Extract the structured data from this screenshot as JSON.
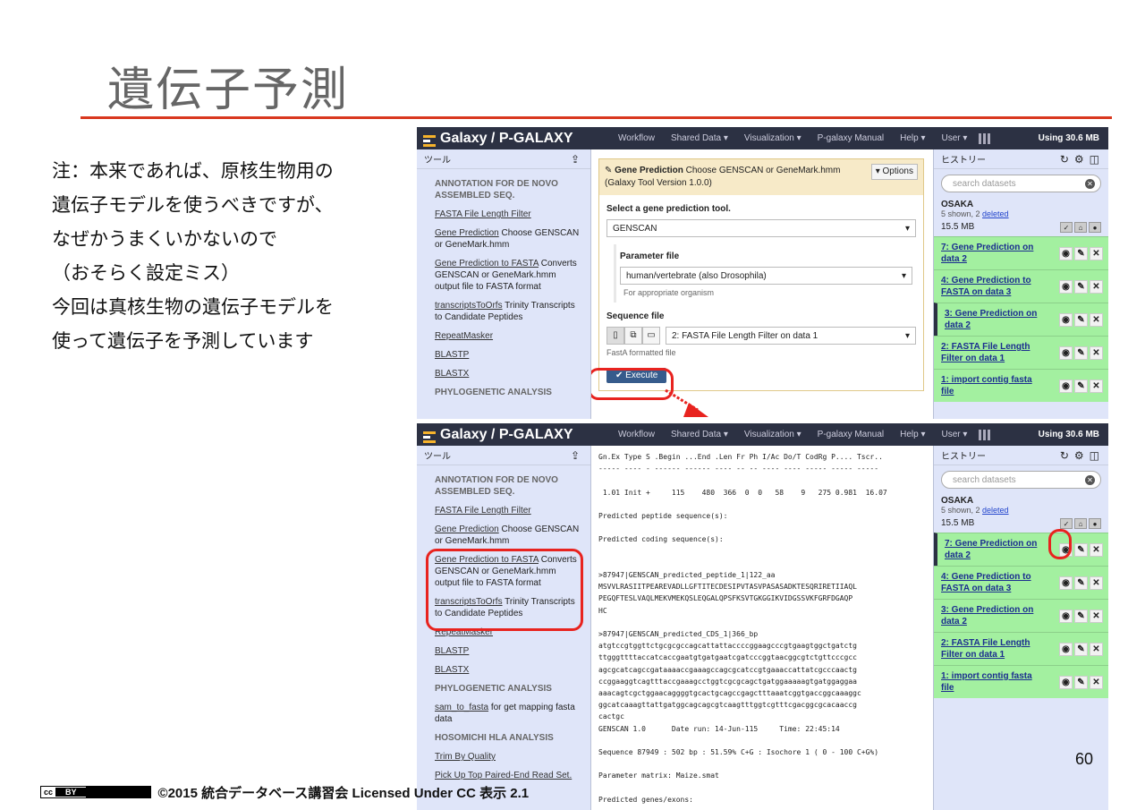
{
  "slide": {
    "title": "遺伝子予測",
    "note_lines": [
      "注：本来であれば、原核生物用の",
      "遺伝子モデルを使うべきですが、",
      "なぜかうまくいかないので",
      "（おそらく設定ミス）",
      "今回は真核生物の遺伝子モデルを",
      "使って遺伝子を予測しています"
    ],
    "page_number": "60",
    "footer": "©2015 統合データベース講習会 Licensed Under CC 表示 2.1",
    "cc_badge": [
      "cc",
      "BY"
    ]
  },
  "galaxy": {
    "brand": "Galaxy / P-GALAXY",
    "brand_overlap": "Data",
    "nav": [
      "Workflow",
      "Shared Data ▾",
      "Visualization ▾",
      "P-galaxy Manual",
      "Help ▾",
      "User ▾"
    ],
    "usage": "Using 30.6 MB",
    "tool_panel": {
      "header": "ツール",
      "items": [
        {
          "type": "section",
          "text": "ANNOTATION FOR DE NOVO ASSEMBLED SEQ."
        },
        {
          "type": "tool",
          "link": "FASTA File Length Filter",
          "desc": ""
        },
        {
          "type": "tool",
          "link": "Gene Prediction",
          "desc": " Choose GENSCAN or GeneMark.hmm"
        },
        {
          "type": "tool",
          "link": "Gene Prediction to FASTA",
          "desc": " Converts GENSCAN or GeneMark.hmm output file to FASTA format"
        },
        {
          "type": "tool",
          "link": "transcriptsToOrfs",
          "desc": " Trinity Transcripts to Candidate Peptides"
        },
        {
          "type": "tool",
          "link": "RepeatMasker",
          "desc": ""
        },
        {
          "type": "tool",
          "link": "BLASTP",
          "desc": ""
        },
        {
          "type": "tool",
          "link": "BLASTX",
          "desc": ""
        },
        {
          "type": "section",
          "text": "PHYLOGENETIC ANALYSIS"
        },
        {
          "type": "tool",
          "link": "sam_to_fasta",
          "desc": " for get mapping fasta data"
        },
        {
          "type": "section",
          "text": "HOSOMICHI HLA ANALYSIS"
        },
        {
          "type": "tool",
          "link": "Trim By Quality",
          "desc": ""
        },
        {
          "type": "tool",
          "link": "Pick Up Top Paired-End Read Set.",
          "desc": ""
        }
      ]
    },
    "tool_form": {
      "title_bold": "Gene Prediction",
      "title_rest": " Choose GENSCAN or GeneMark.hmm (Galaxy Tool Version 1.0.0)",
      "options_label": "▾ Options",
      "select_label": "Select a gene prediction tool.",
      "select_value": "GENSCAN",
      "param_label": "Parameter file",
      "param_value": "human/vertebrate (also Drosophila)",
      "param_help": "For appropriate organism",
      "seq_label": "Sequence file",
      "seq_value": "2: FASTA File Length Filter on data 1",
      "seq_help": "FastA formatted file",
      "execute_label": "✔ Execute"
    },
    "history": {
      "header": "ヒストリー",
      "search_placeholder": "search datasets",
      "name": "OSAKA",
      "shown": "5 shown, 2 ",
      "deleted": "deleted",
      "size": "15.5 MB",
      "datasets": [
        {
          "label": "7: Gene Prediction on data 2",
          "current": false
        },
        {
          "label": "4: Gene Prediction to FASTA on data 3",
          "current": false
        },
        {
          "label": "3: Gene Prediction on data 2",
          "current": true
        },
        {
          "label": "2: FASTA File Length Filter on data 1",
          "current": false
        },
        {
          "label": "1: import contig fasta file",
          "current": false
        }
      ],
      "datasets2": [
        {
          "label": "7: Gene Prediction on data 2",
          "current": true
        },
        {
          "label": "4: Gene Prediction to FASTA on data 3",
          "current": false
        },
        {
          "label": "3: Gene Prediction on data 2",
          "current": false
        },
        {
          "label": "2: FASTA File Length Filter on data 1",
          "current": false
        },
        {
          "label": "1: import contig fasta file",
          "current": false
        }
      ]
    },
    "output_text": "Gn.Ex Type S .Begin ...End .Len Fr Ph I/Ac Do/T CodRg P.... Tscr..\n----- ---- - ------ ------ ---- -- -- ---- ---- ----- ----- -----\n\n 1.01 Init +     115    480  366  0  0   58    9   275 0.981  16.07\n\nPredicted peptide sequence(s):\n\nPredicted coding sequence(s):\n\n\n>87947|GENSCAN_predicted_peptide_1|122_aa\nMSVVLRASIITPEAREVADLLGFTITECDESIPVTASVPASASADKTESQRIRETIIAQL\nPEGQFTESLVAQLMEKVMEKQSLEQGALQPSFKSVTGKGGIKVIDGSSVKFGRFDGAQP\nHC\n\n>87947|GENSCAN_predicted_CDS_1|366_bp\natgtccgtggttctgcgcgccagcattattaccccggaagcccgtgaagtggctgatctg\nttgggttttaccatcaccgaatgtgatgaatcgatcccggtaacggcgtctgttcccgcc\nagcgcatcagccgataaaaccgaaagccagcgcatccgtgaaaccattatcgcccaactg\nccggaaggtcagtttaccgaaagcctggtcgcgcagctgatggaaaaagtgatggaggaa\naaacagtcgctggaacaggggtgcactgcagccgagctttaaatcggtgaccggcaaaggc\nggcatcaaagttattgatggcagcagcgtcaagtttggtcgtttcgacggcgcacaaccg\ncactgc\nGENSCAN 1.0      Date run: 14-Jun-115     Time: 22:45:14\n\nSequence 87949 : 502 bp : 51.59% C+G : Isochore 1 ( 0 - 100 C+G%)\n\nParameter matrix: Maize.smat\n\nPredicted genes/exons:"
  }
}
